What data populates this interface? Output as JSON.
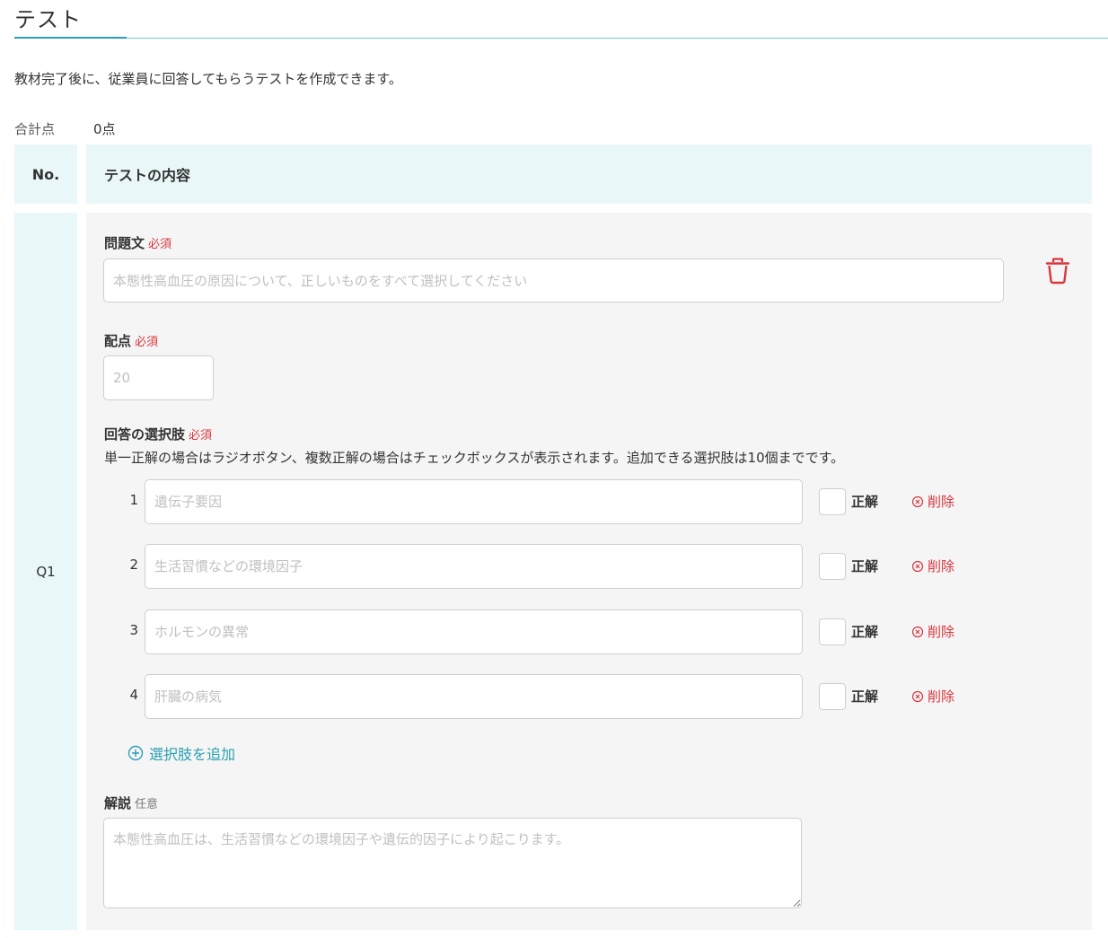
{
  "page": {
    "title": "テスト",
    "description": "教材完了後に、従業員に回答してもらうテストを作成できます。",
    "total_label": "合計点",
    "total_value": "0点"
  },
  "table": {
    "header_no": "No.",
    "header_content": "テストの内容"
  },
  "question": {
    "number": "Q1",
    "text_label": "問題文",
    "text_required": "必須",
    "text_placeholder": "本態性高血圧の原因について、正しいものをすべて選択してください",
    "points_label": "配点",
    "points_required": "必須",
    "points_placeholder": "20",
    "choices_label": "回答の選択肢",
    "choices_required": "必須",
    "choices_help": "単一正解の場合はラジオボタン、複数正解の場合はチェックボックスが表示されます。追加できる選択肢は10個までです。",
    "choices": [
      {
        "num": "1",
        "placeholder": "遺伝子要因",
        "correct_label": "正解",
        "delete_label": "削除",
        "checked": false
      },
      {
        "num": "2",
        "placeholder": "生活習慣などの環境因子",
        "correct_label": "正解",
        "delete_label": "削除",
        "checked": false
      },
      {
        "num": "3",
        "placeholder": "ホルモンの異常",
        "correct_label": "正解",
        "delete_label": "削除",
        "checked": false
      },
      {
        "num": "4",
        "placeholder": "肝臓の病気",
        "correct_label": "正解",
        "delete_label": "削除",
        "checked": false
      }
    ],
    "add_choice_label": "選択肢を追加",
    "explanation_label": "解説",
    "explanation_optional": "任意",
    "explanation_placeholder": "本態性高血圧は、生活習慣などの環境因子や遺伝的因子により起こります。"
  },
  "colors": {
    "accent": "#2a9fb3",
    "danger": "#d9363e",
    "header_bg": "#e9f7f8",
    "panel_bg": "#f5f5f5"
  },
  "icons": {
    "trash": "trash-icon",
    "delete": "circle-x-icon",
    "add": "circle-plus-icon"
  }
}
